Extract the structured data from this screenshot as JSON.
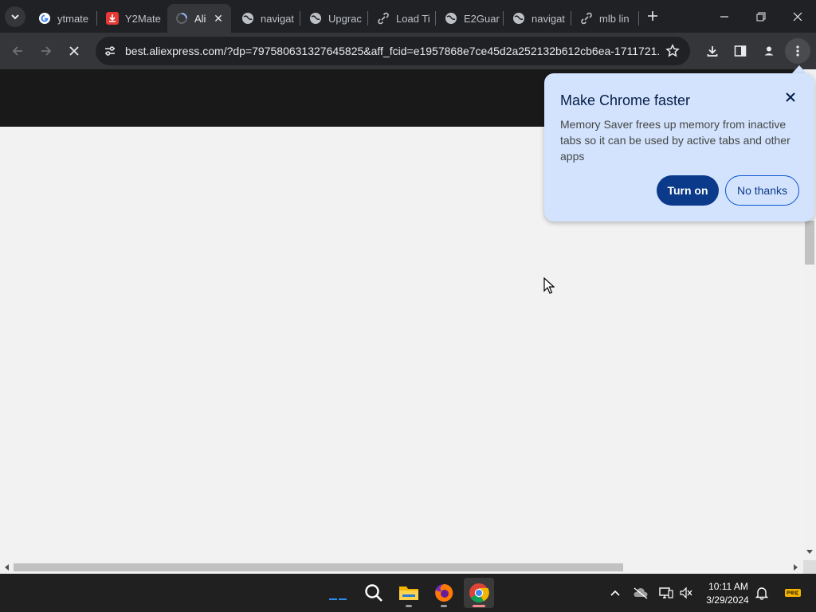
{
  "browser": {
    "tabs": [
      {
        "title": "ytmate",
        "icon": "google-icon"
      },
      {
        "title": "Y2Mate",
        "icon": "y2mate-download-icon"
      },
      {
        "title": "Ali",
        "icon": "loading-spinner-icon",
        "active": true
      },
      {
        "title": "navigat",
        "icon": "globe-icon"
      },
      {
        "title": "Upgrac",
        "icon": "globe-icon"
      },
      {
        "title": "Load Ti",
        "icon": "link-icon"
      },
      {
        "title": "E2Guar",
        "icon": "globe-icon"
      },
      {
        "title": "navigat",
        "icon": "globe-icon"
      },
      {
        "title": "mlb lin",
        "icon": "link-icon"
      }
    ],
    "url": "best.aliexpress.com/?dp=797580631327645825&aff_fcid=e1957868e7ce45d2a252132b612cb6ea-1711721..."
  },
  "bubble": {
    "title": "Make Chrome faster",
    "body": "Memory Saver frees up memory from inactive tabs so it can be used by active tabs and other apps",
    "turn_on_label": "Turn on",
    "no_thanks_label": "No thanks"
  },
  "taskbar": {
    "time": "10:11 AM",
    "date": "3/29/2024"
  },
  "colors": {
    "bubble_bg": "#d3e3fd",
    "primary_button": "#0b3a8a",
    "page_header": "#191919"
  }
}
